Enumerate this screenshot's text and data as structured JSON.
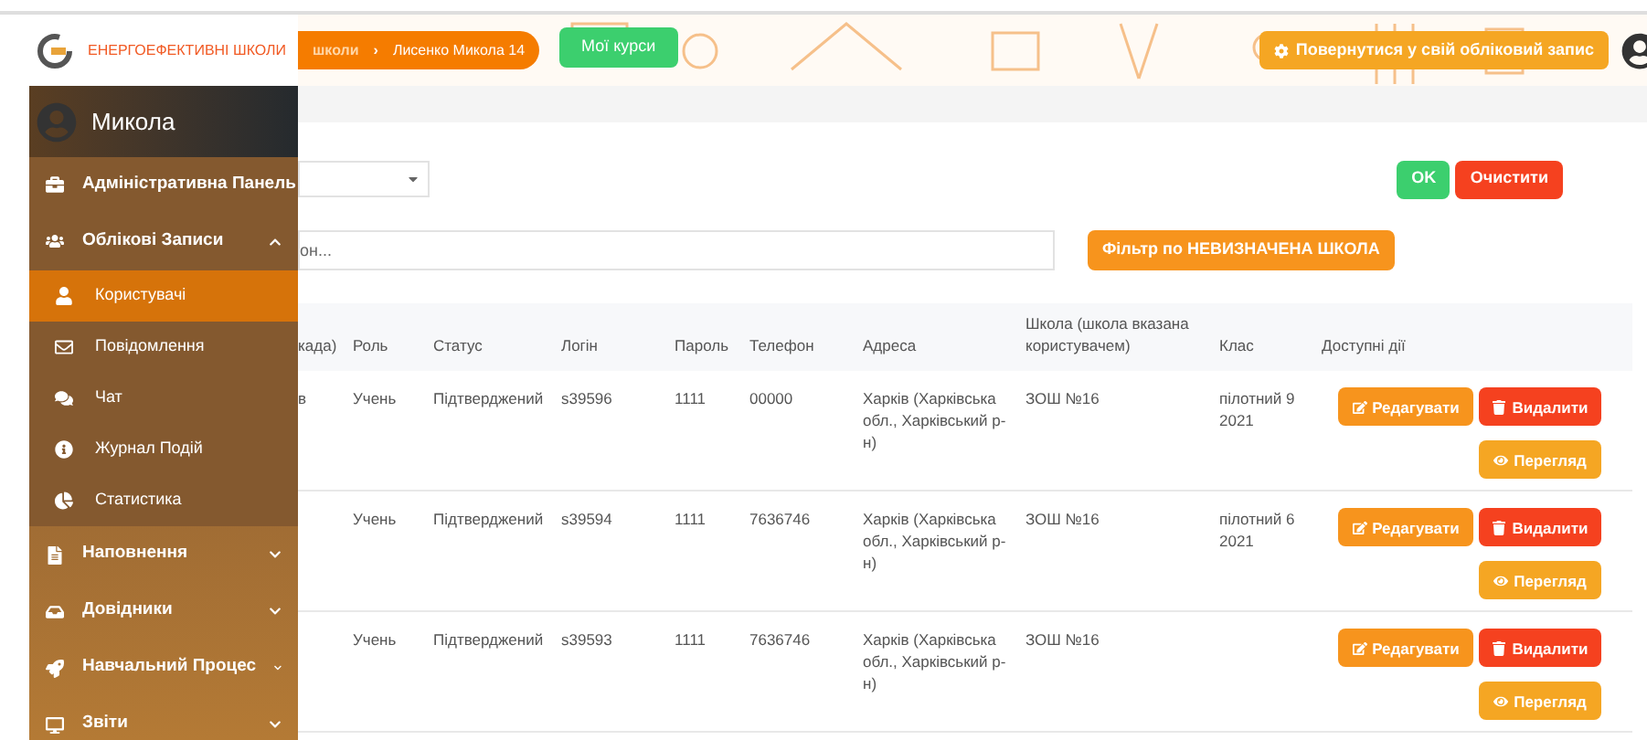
{
  "header": {
    "brand": "ЕНЕРГОЕФЕКТИВНІ ШКОЛИ",
    "breadcrumb": [
      "школи",
      "Лисенко Микола 14"
    ],
    "breadcrumb_separator": "›",
    "courses_button": "Мої курси",
    "return_button": "Повернутися у свій обліковий запис"
  },
  "sidebar": {
    "user": "Микола",
    "items": [
      {
        "label": "Адміністративна Панель"
      },
      {
        "label": "Облікові Записи",
        "expanded": true,
        "children": [
          {
            "label": "Користувачі",
            "selected": true
          },
          {
            "label": "Повідомлення",
            "selected": false
          },
          {
            "label": "Чат",
            "selected": false
          },
          {
            "label": "Журнал Подій",
            "selected": false
          },
          {
            "label": "Статистика",
            "selected": false
          }
        ]
      },
      {
        "label": "Наповнення",
        "expanded": false
      },
      {
        "label": "Довідники",
        "expanded": false
      },
      {
        "label": "Навчальний Процес",
        "expanded": false
      },
      {
        "label": "Звіти",
        "expanded": false
      }
    ]
  },
  "filters": {
    "search": {
      "placeholder": "он..."
    },
    "ok_button": "OK",
    "clear_button": "Очистити",
    "school_filter_button": "Фільтр по НЕВИЗНАЧЕНА ШКОЛА"
  },
  "table": {
    "columns": [
      "када)",
      "Роль",
      "Статус",
      "Логін",
      "Пароль",
      "Телефон",
      "Адреса",
      "Школа (школа вказана користувачем)",
      "Клас",
      "Доступні дії"
    ],
    "rows": [
      {
        "cells": [
          "в",
          "Учень",
          "Підтверджений",
          "s39596",
          "1111",
          "00000",
          "Харків (Харківська обл., Харківський р-н)",
          "ЗОШ №16",
          "пілотний 9 2021"
        ],
        "actions": [
          {
            "kind": "edit",
            "label": "Редагувати"
          },
          {
            "kind": "delete",
            "label": "Видалити"
          },
          {
            "kind": "view",
            "label": "Перегляд"
          }
        ]
      },
      {
        "cells": [
          "",
          "Учень",
          "Підтверджений",
          "s39594",
          "1111",
          "7636746",
          "Харків (Харківська обл., Харківський р-н)",
          "ЗОШ №16",
          "пілотний 6 2021"
        ],
        "actions": [
          {
            "kind": "edit",
            "label": "Редагувати"
          },
          {
            "kind": "delete",
            "label": "Видалити"
          },
          {
            "kind": "view",
            "label": "Перегляд"
          }
        ]
      },
      {
        "cells": [
          "",
          "Учень",
          "Підтверджений",
          "s39593",
          "1111",
          "7636746",
          "Харків (Харківська обл., Харківський р-н)",
          "ЗОШ №16",
          ""
        ],
        "actions": [
          {
            "kind": "edit",
            "label": "Редагувати"
          },
          {
            "kind": "delete",
            "label": "Видалити"
          },
          {
            "kind": "view",
            "label": "Перегляд"
          }
        ]
      }
    ]
  }
}
